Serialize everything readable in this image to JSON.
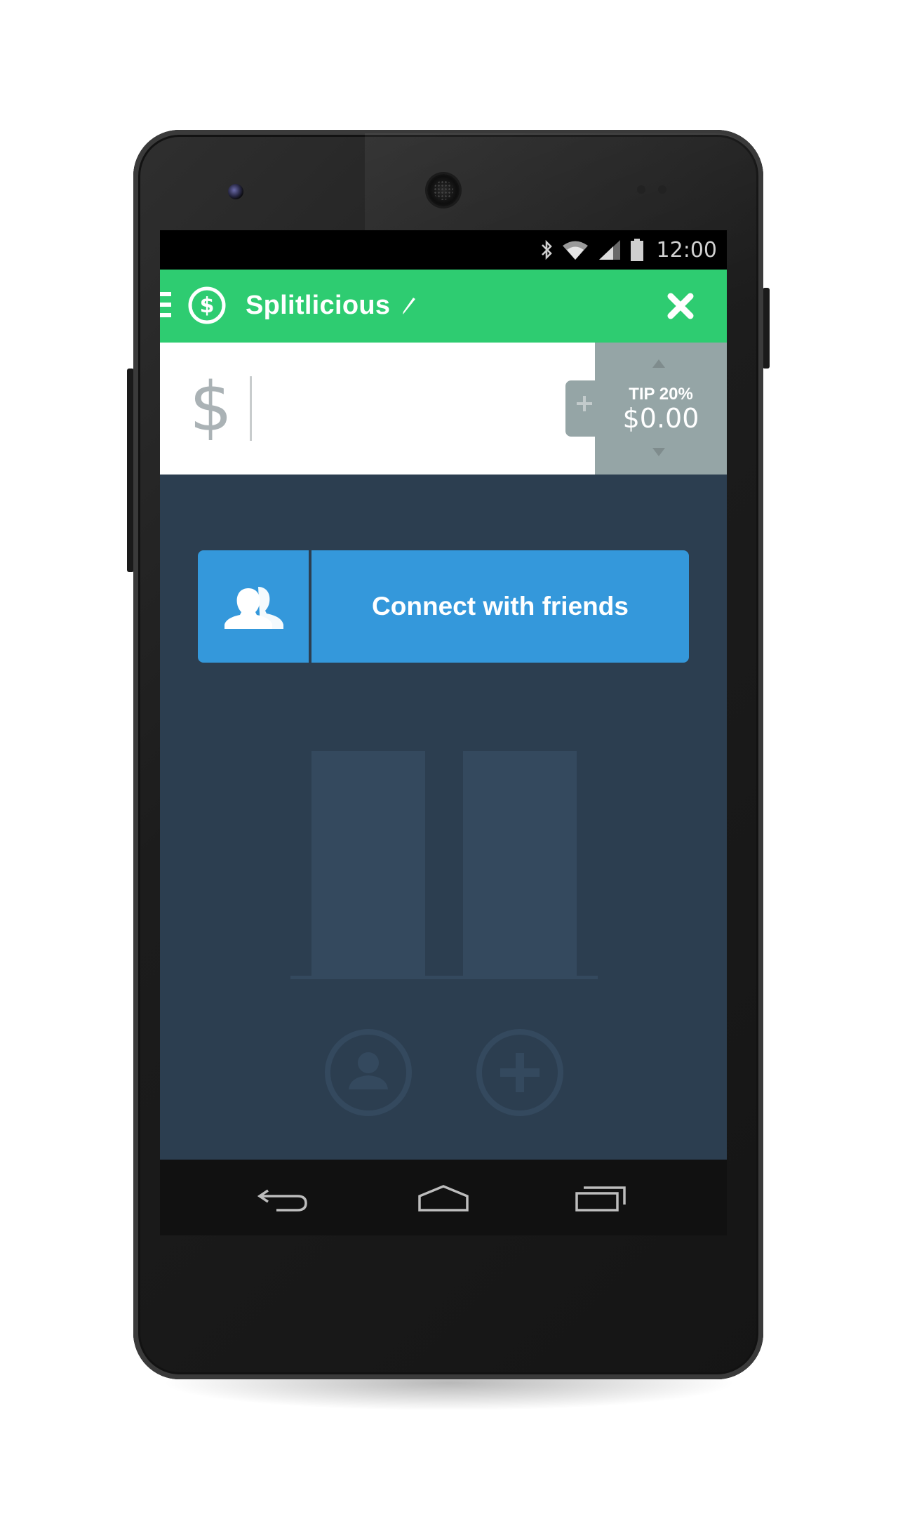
{
  "status_bar": {
    "time": "12:00",
    "icons": [
      "bluetooth-icon",
      "wifi-icon",
      "signal-icon",
      "battery-icon"
    ]
  },
  "app_bar": {
    "title": "Splitlicious",
    "icons": [
      "menu-icon",
      "dollar-circle-icon",
      "pencil-icon",
      "close-icon"
    ]
  },
  "amount": {
    "currency_symbol": "$",
    "value": ""
  },
  "tip": {
    "label": "TIP 20%",
    "value": "$0.00",
    "icons": [
      "plus-icon",
      "arrow-up-icon",
      "arrow-down-icon"
    ]
  },
  "connect": {
    "label": "Connect with friends",
    "icon": "friends-icon"
  },
  "empty_state": {
    "icons": [
      "person-circle-icon",
      "plus-circle-icon"
    ]
  },
  "nav": {
    "icons": [
      "back-icon",
      "home-icon",
      "recents-icon"
    ]
  },
  "colors": {
    "brand_green": "#2ecc71",
    "connect_blue": "#3498db",
    "background_navy": "#2c3e50",
    "ghost_navy": "#34495e",
    "tip_gray": "#95a5a6"
  }
}
